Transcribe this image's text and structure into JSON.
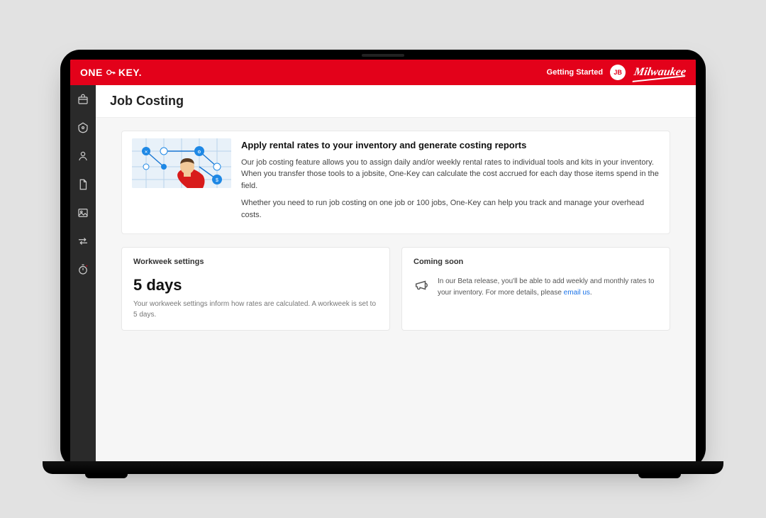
{
  "header": {
    "product_name": "ONE KEY.",
    "getting_started": "Getting Started",
    "avatar_initials": "JB",
    "brand": "Milwaukee"
  },
  "sidebar": {
    "items": [
      {
        "name": "inventory-icon"
      },
      {
        "name": "tool-tag-icon"
      },
      {
        "name": "person-icon"
      },
      {
        "name": "document-icon"
      },
      {
        "name": "image-icon"
      },
      {
        "name": "transfer-icon"
      },
      {
        "name": "timer-icon"
      }
    ]
  },
  "page": {
    "title": "Job Costing"
  },
  "hero": {
    "title": "Apply rental rates to your inventory and generate costing reports",
    "p1": "Our job costing feature allows you to assign daily and/or weekly rental rates to individual tools and kits in your inventory. When you transfer those tools to a jobsite, One-Key can calculate the cost accrued for each day those items spend in the field.",
    "p2": "Whether you need to run job costing on one job or 100 jobs, One-Key can help you track and manage your overhead costs."
  },
  "workweek": {
    "label": "Workweek settings",
    "value": "5 days",
    "desc": "Your workweek settings inform how rates are calculated. A workweek is set to 5 days."
  },
  "coming": {
    "label": "Coming soon",
    "text_prefix": "In our Beta release, you'll be able to add weekly and monthly rates to your inventory. For more details, please ",
    "link": "email us",
    "text_suffix": "."
  }
}
